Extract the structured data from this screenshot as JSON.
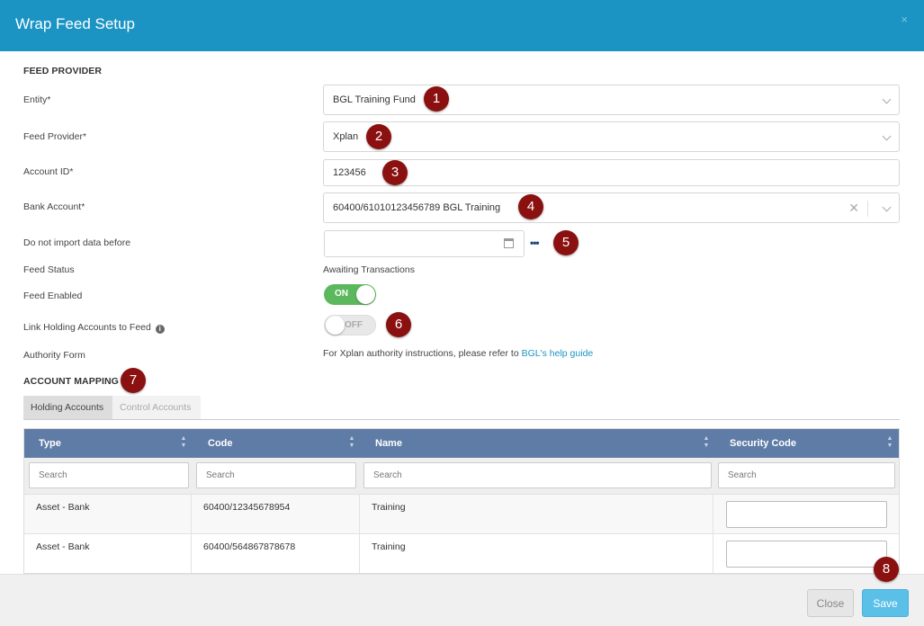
{
  "dialog": {
    "title": "Wrap Feed Setup",
    "close_glyph": "×"
  },
  "feed_provider": {
    "section_title": "FEED PROVIDER",
    "entity": {
      "label": "Entity*",
      "value": "BGL Training Fund"
    },
    "provider": {
      "label": "Feed Provider*",
      "value": "Xplan"
    },
    "account_id": {
      "label": "Account ID*",
      "value": "123456"
    },
    "bank_account": {
      "label": "Bank Account*",
      "value": "60400/61010123456789 BGL Training",
      "clear_glyph": "✕"
    },
    "import_before": {
      "label": "Do not import data before",
      "value": "",
      "more_glyph": "•••"
    },
    "status": {
      "label": "Feed Status",
      "value": "Awaiting Transactions"
    },
    "enabled": {
      "label": "Feed Enabled",
      "state": "ON"
    },
    "link_holding": {
      "label": "Link Holding Accounts to Feed",
      "info_glyph": "i",
      "state": "OFF"
    },
    "authority": {
      "label": "Authority Form",
      "text": "For Xplan authority instructions, please refer to ",
      "link": "BGL's help guide"
    }
  },
  "account_mapping": {
    "section_title": "ACCOUNT MAPPING",
    "tabs": [
      "Holding Accounts",
      "Control Accounts"
    ],
    "columns": [
      "Type",
      "Code",
      "Name",
      "Security Code"
    ],
    "sort_glyphs": {
      "up": "▲",
      "down": "▼"
    },
    "filter_placeholder": "Search",
    "rows": [
      {
        "type": "Asset - Bank",
        "code": "60400/12345678954",
        "name": "Training",
        "security_code": ""
      },
      {
        "type": "Asset - Bank",
        "code": "60400/564867878678",
        "name": "Training",
        "security_code": ""
      }
    ]
  },
  "callouts": [
    "1",
    "2",
    "3",
    "4",
    "5",
    "6",
    "7",
    "8"
  ],
  "footer": {
    "close_label": "Close",
    "save_label": "Save"
  },
  "colors": {
    "header": "#1b94c4",
    "grid_header": "#5e7ca6",
    "callout": "#8b1010",
    "toggle_on": "#5cb85c",
    "save": "#5bc0e8"
  }
}
